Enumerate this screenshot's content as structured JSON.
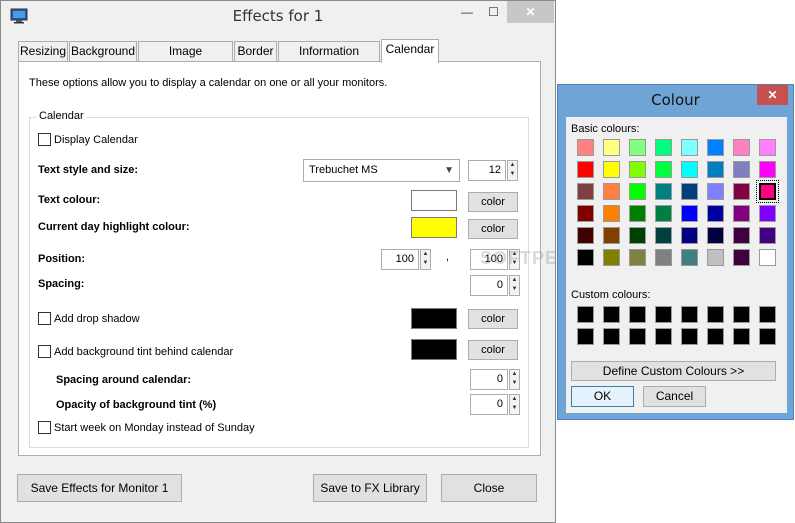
{
  "main_window": {
    "title": "Effects for 1",
    "buttons": {
      "minimize": "—",
      "maximize": "☐",
      "close": "✕"
    },
    "tabs": [
      "Resizing",
      "Background",
      "Image Processing",
      "Border",
      "Information Display",
      "Calendar"
    ],
    "active_tab": "Calendar",
    "description": "These options allow you to display a calendar on one or all your monitors.",
    "group_title": "Calendar",
    "display_calendar": "Display Calendar",
    "text_style_label": "Text style and size:",
    "font_name": "Trebuchet MS",
    "font_size": "12",
    "text_colour_label": "Text colour:",
    "text_colour": "#ffffff",
    "highlight_label": "Current day highlight colour:",
    "highlight_colour": "#ffff00",
    "position_label": "Position:",
    "position_x": "100",
    "position_sep": ",",
    "position_y": "100",
    "spacing_label": "Spacing:",
    "spacing": "0",
    "drop_shadow": "Add drop shadow",
    "shadow_colour": "#000000",
    "bg_tint": "Add background tint behind calendar",
    "tint_colour": "#000000",
    "spacing_around_label": "Spacing around calendar:",
    "spacing_around": "0",
    "opacity_label": "Opacity of background tint (%)",
    "opacity": "0",
    "week_monday": "Start week on Monday instead of Sunday",
    "color_button": "color",
    "save_monitor": "Save Effects for Monitor 1",
    "save_fx": "Save to FX Library",
    "close": "Close"
  },
  "colour_dialog": {
    "title": "Colour",
    "close": "✕",
    "basic_label": "Basic colours:",
    "custom_label": "Custom colours:",
    "define_button": "Define Custom Colours >>",
    "ok": "OK",
    "cancel": "Cancel",
    "selected_index": 23,
    "basic_colours": [
      "#ff8080",
      "#ffff80",
      "#80ff80",
      "#00ff80",
      "#80ffff",
      "#0080ff",
      "#ff80c0",
      "#ff80ff",
      "#ff0000",
      "#ffff00",
      "#80ff00",
      "#00ff40",
      "#00ffff",
      "#0080c0",
      "#8080c0",
      "#ff00ff",
      "#804040",
      "#ff8040",
      "#00ff00",
      "#008080",
      "#004080",
      "#8080ff",
      "#800040",
      "#ff0080",
      "#800000",
      "#ff8000",
      "#008000",
      "#008040",
      "#0000ff",
      "#0000a0",
      "#800080",
      "#8000ff",
      "#400000",
      "#804000",
      "#004000",
      "#004040",
      "#000080",
      "#000040",
      "#400040",
      "#400080",
      "#000000",
      "#808000",
      "#808040",
      "#808080",
      "#408080",
      "#c0c0c0",
      "#400040",
      "#ffffff"
    ],
    "custom_colours": [
      "#000000",
      "#000000",
      "#000000",
      "#000000",
      "#000000",
      "#000000",
      "#000000",
      "#000000",
      "#000000",
      "#000000",
      "#000000",
      "#000000",
      "#000000",
      "#000000",
      "#000000",
      "#000000"
    ]
  },
  "watermark": "SOFTPEDIA"
}
